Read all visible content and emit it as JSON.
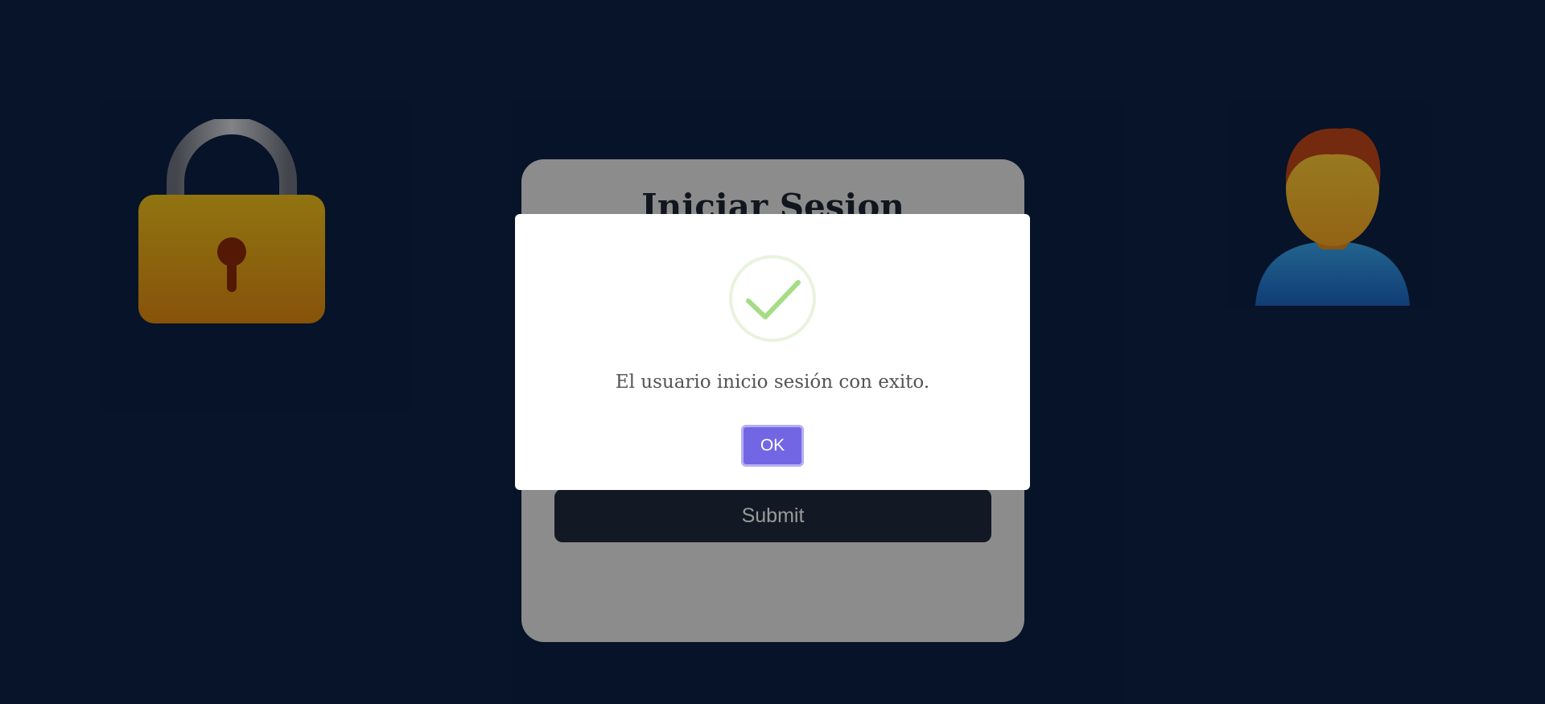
{
  "login_card": {
    "title": "Iniciar Sesion",
    "submit_label": "Submit"
  },
  "alert": {
    "icon": "success-check-icon",
    "message": "El usuario inicio sesión con exito.",
    "ok_label": "OK"
  },
  "decorations": {
    "left_image": "padlock-icon",
    "right_image": "user-avatar-icon"
  },
  "colors": {
    "page_background": "#0b2144",
    "ok_button": "#7366e4",
    "success_icon": "#a5dc86",
    "submit_button": "#1f2b3d"
  }
}
